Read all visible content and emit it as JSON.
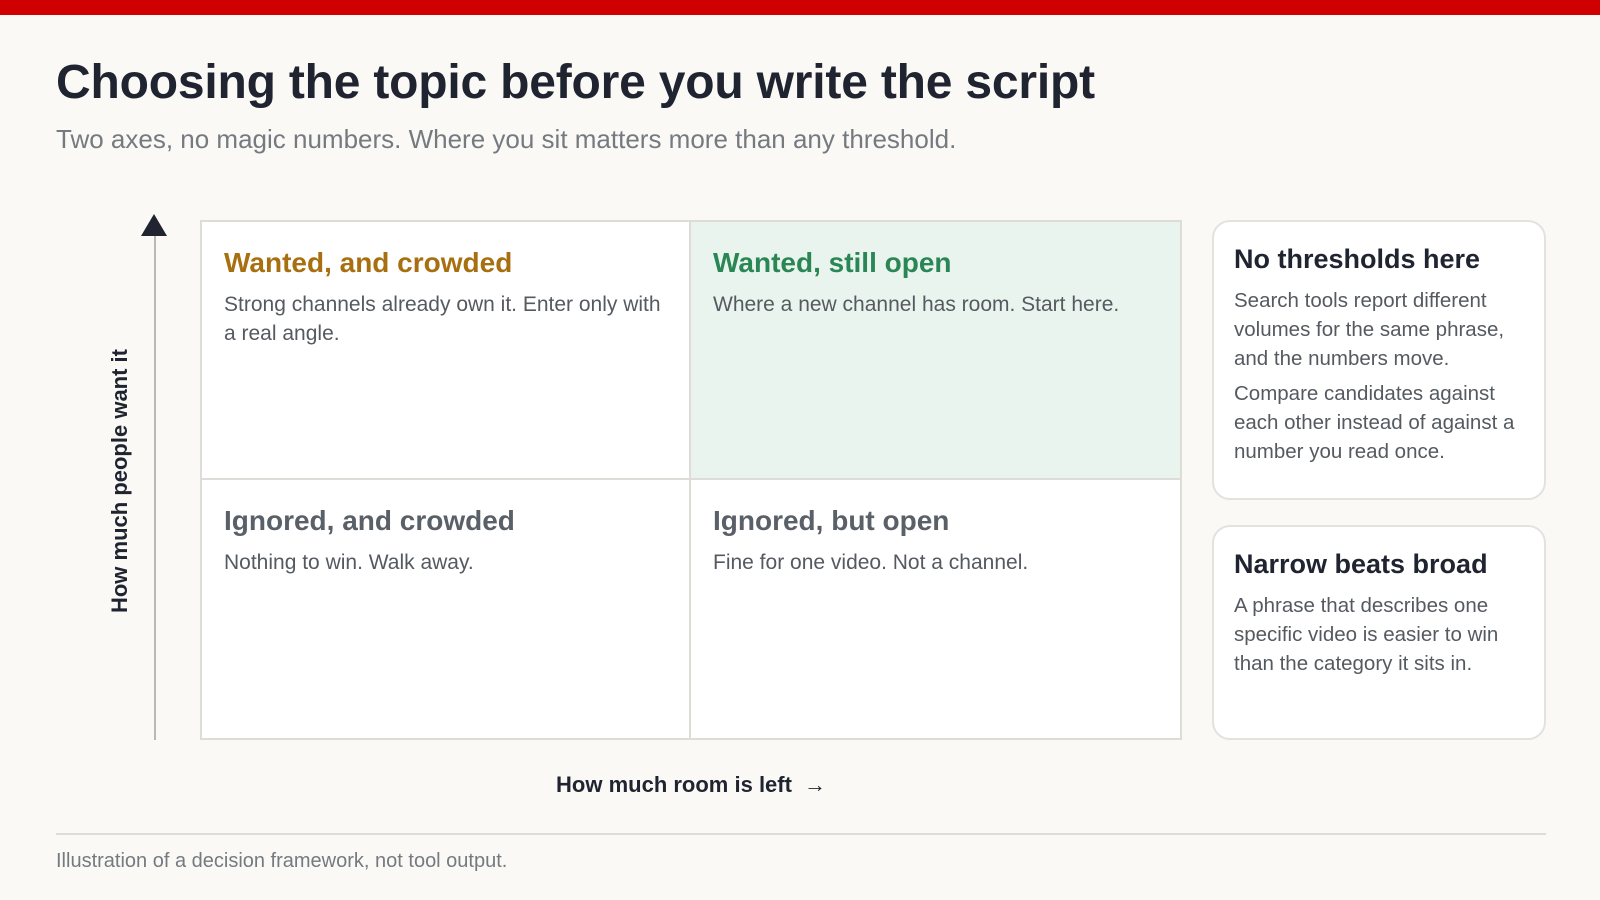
{
  "header": {
    "title": "Choosing the topic before you write the script",
    "subtitle": "Two axes, no magic numbers. Where you sit matters more than any threshold."
  },
  "axes": {
    "y_label": "How much people want it",
    "x_label": "How much room is left",
    "x_arrow": "→"
  },
  "quadrants": {
    "top_left": {
      "title": "Wanted, and crowded",
      "body": "Strong channels already own it. Enter only with a real angle."
    },
    "top_right": {
      "title": "Wanted, still open",
      "body": "Where a new channel has room. Start here."
    },
    "bottom_left": {
      "title": "Ignored, and crowded",
      "body": "Nothing to win. Walk away."
    },
    "bottom_right": {
      "title": "Ignored, but open",
      "body": "Fine for one video. Not a channel."
    }
  },
  "cards": [
    {
      "title": "No thresholds here",
      "paragraphs": [
        "Search tools report different volumes for the same phrase, and the numbers move.",
        "Compare candidates against each other instead of against a number you read once."
      ]
    },
    {
      "title": "Narrow beats broad",
      "paragraphs": [
        "A phrase that describes one specific video is easier to win than the category it sits in."
      ]
    }
  ],
  "footer": {
    "note": "Illustration of a decision framework, not tool output."
  },
  "colors": {
    "accent_bar": "#d00000",
    "crowded_title": "#a86f10",
    "open_title": "#2b8655",
    "ignored_title": "#5a6068",
    "highlight_fill": "#eaf4ee"
  }
}
